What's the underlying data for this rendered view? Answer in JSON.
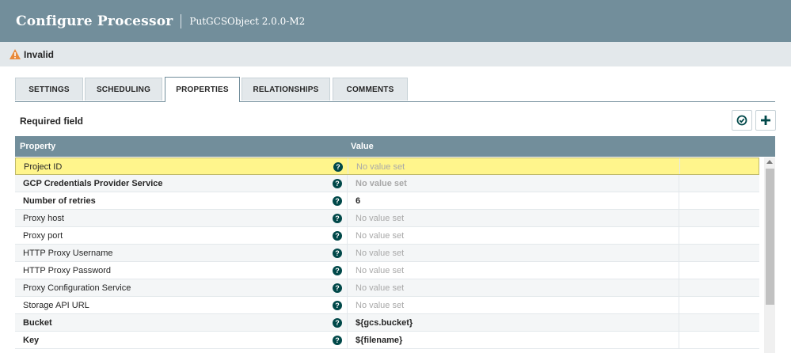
{
  "header": {
    "title": "Configure Processor",
    "subtitle": "PutGCSObject 2.0.0-M2"
  },
  "status": {
    "text": "Invalid",
    "icon": "warning-icon",
    "color": "#e98a3a"
  },
  "tabs": [
    {
      "label": "SETTINGS",
      "active": false
    },
    {
      "label": "SCHEDULING",
      "active": false
    },
    {
      "label": "PROPERTIES",
      "active": true
    },
    {
      "label": "RELATIONSHIPS",
      "active": false
    },
    {
      "label": "COMMENTS",
      "active": false
    }
  ],
  "properties": {
    "required_label": "Required field",
    "verify_icon": "check-circle-icon",
    "add_icon": "plus-icon",
    "columns": {
      "property": "Property",
      "value": "Value"
    },
    "rows": [
      {
        "name": "Project ID",
        "value": "No value set",
        "required": false,
        "unset": true,
        "highlight": true
      },
      {
        "name": "GCP Credentials Provider Service",
        "value": "No value set",
        "required": true,
        "unset": true
      },
      {
        "name": "Number of retries",
        "value": "6",
        "required": true,
        "unset": false
      },
      {
        "name": "Proxy host",
        "value": "No value set",
        "required": false,
        "unset": true
      },
      {
        "name": "Proxy port",
        "value": "No value set",
        "required": false,
        "unset": true
      },
      {
        "name": "HTTP Proxy Username",
        "value": "No value set",
        "required": false,
        "unset": true
      },
      {
        "name": "HTTP Proxy Password",
        "value": "No value set",
        "required": false,
        "unset": true
      },
      {
        "name": "Proxy Configuration Service",
        "value": "No value set",
        "required": false,
        "unset": true
      },
      {
        "name": "Storage API URL",
        "value": "No value set",
        "required": false,
        "unset": true
      },
      {
        "name": "Bucket",
        "value": "${gcs.bucket}",
        "required": true,
        "unset": false
      },
      {
        "name": "Key",
        "value": "${filename}",
        "required": true,
        "unset": false
      }
    ],
    "help_glyph": "?"
  },
  "colors": {
    "header": "#728e9b",
    "help_icon": "#004849",
    "highlight": "#fff58c"
  }
}
